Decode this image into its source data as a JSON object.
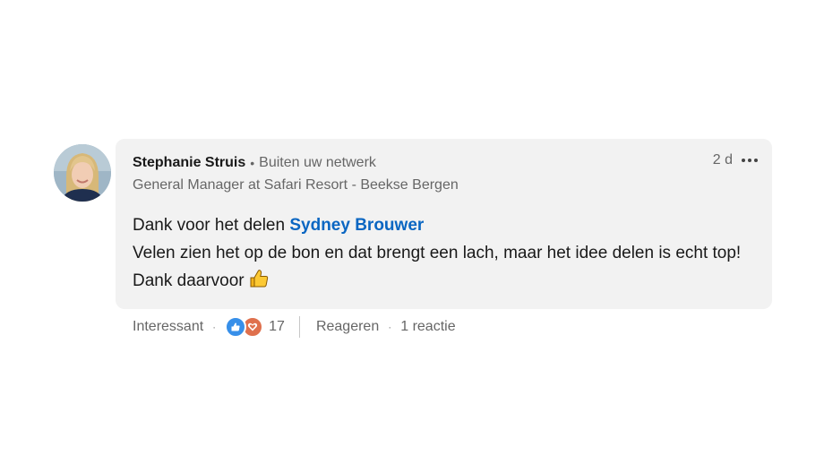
{
  "comment": {
    "author_name": "Stephanie Struis",
    "separator": "•",
    "network_status": "Buiten uw netwerk",
    "author_headline": "General Manager at Safari Resort - Beekse Bergen",
    "time_ago": "2 d",
    "text_intro": "Dank voor het delen",
    "mention": "Sydney Brouwer",
    "text_body": "Velen zien het op de bon en dat brengt een lach, maar het idee delen is echt top! Dank daarvoor",
    "emoji_icon": "thumbs-up-icon"
  },
  "actions": {
    "reaction_label": "Interessant",
    "dot": "·",
    "reaction_count": "17",
    "reply_label": "Reageren",
    "reply_count": "1 reactie"
  },
  "colors": {
    "accent": "#0a66c2",
    "bubble_bg": "#f2f2f2",
    "like": "#378fe9",
    "love": "#df704d"
  }
}
